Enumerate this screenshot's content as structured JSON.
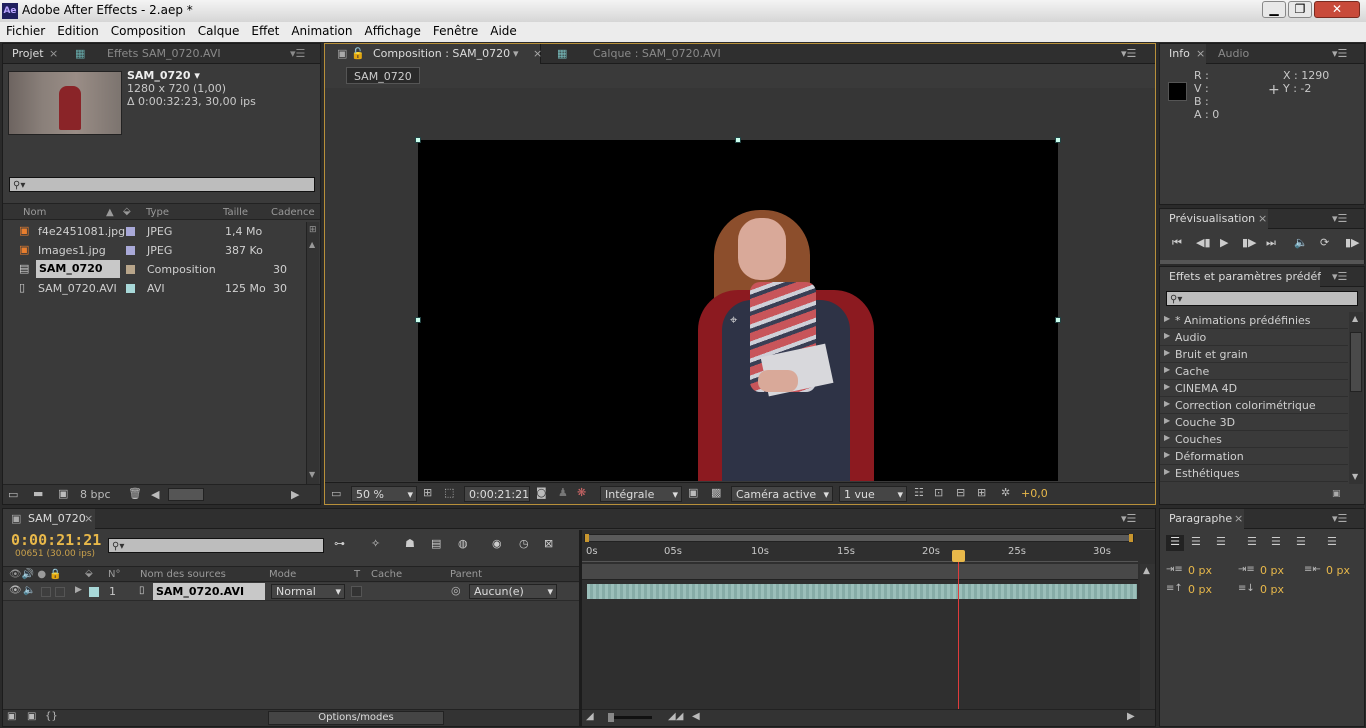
{
  "window": {
    "title": "Adobe After Effects - 2.aep *",
    "logo": "Ae"
  },
  "menu": [
    "Fichier",
    "Edition",
    "Composition",
    "Calque",
    "Effet",
    "Animation",
    "Affichage",
    "Fenêtre",
    "Aide"
  ],
  "project": {
    "tab_projet": "Projet",
    "tab_effets": "Effets SAM_0720.AVI",
    "selected_name": "SAM_0720 ▾",
    "selected_dims": "1280 x 720 (1,00)",
    "selected_duration": "Δ 0:00:32:23, 30,00 ips",
    "columns": {
      "name": "Nom",
      "type": "Type",
      "size": "Taille",
      "rate": "Cadence"
    },
    "items": [
      {
        "name": "f4e2451081.jpg",
        "type": "JPEG",
        "size": "1,4 Mo",
        "rate": "",
        "color": "#a9a9d8"
      },
      {
        "name": "Images1.jpg",
        "type": "JPEG",
        "size": "387 Ko",
        "rate": "",
        "color": "#a9a9d8"
      },
      {
        "name": "SAM_0720",
        "type": "Composition",
        "size": "",
        "rate": "30",
        "color": "#b8a58a"
      },
      {
        "name": "SAM_0720.AVI",
        "type": "AVI",
        "size": "125 Mo",
        "rate": "30",
        "color": "#a8d8d8"
      }
    ],
    "bpc": "8 bpc"
  },
  "comp": {
    "tab_comp": "Composition : SAM_0720",
    "tab_layer": "Calque : SAM_0720.AVI",
    "breadcrumb": "SAM_0720",
    "zoom": "50 %",
    "timecode": "0:00:21:21",
    "resolution": "Intégrale",
    "camera": "Caméra active",
    "views": "1 vue",
    "exposure": "+0,0"
  },
  "info": {
    "tab_info": "Info",
    "tab_audio": "Audio",
    "r": "R :",
    "v": "V :",
    "b": "B :",
    "a": "A : 0",
    "x": "X : 1290",
    "y": "Y : -2"
  },
  "preview": {
    "title": "Prévisualisation"
  },
  "effects": {
    "title": "Effets et paramètres prédéfinis",
    "items": [
      "* Animations prédéfinies",
      "Audio",
      "Bruit et grain",
      "Cache",
      "CINEMA 4D",
      "Correction colorimétrique",
      "Couche 3D",
      "Couches",
      "Déformation",
      "Esthétiques"
    ]
  },
  "timeline": {
    "tab": "SAM_0720",
    "timecode": "0:00:21:21",
    "frames": "00651 (30.00 ips)",
    "columns": {
      "num": "N°",
      "source": "Nom des sources",
      "mode": "Mode",
      "t": "T",
      "cache": "Cache",
      "parent": "Parent"
    },
    "layer": {
      "num": "1",
      "name": "SAM_0720.AVI",
      "mode": "Normal",
      "parent": "Aucun(e)"
    },
    "ruler": [
      "0s",
      "05s",
      "10s",
      "15s",
      "20s",
      "25s",
      "30s"
    ],
    "options": "Options/modes"
  },
  "paragraph": {
    "title": "Paragraphe",
    "indent_left": "0 px",
    "indent_first": "0 px",
    "indent_right": "0 px",
    "space_before": "0 px",
    "space_after": "0 px"
  }
}
